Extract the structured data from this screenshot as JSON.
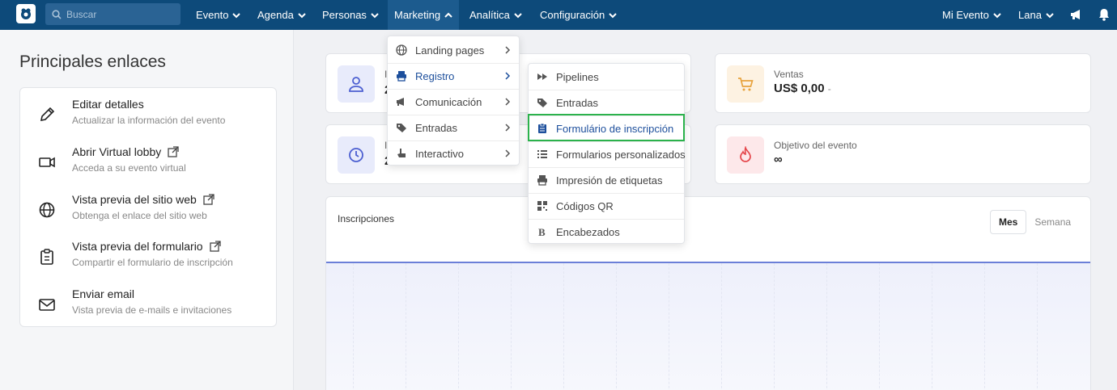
{
  "topbar": {
    "search_placeholder": "Buscar",
    "nav": [
      "Evento",
      "Agenda",
      "Personas",
      "Marketing",
      "Analítica",
      "Configuración"
    ],
    "right": [
      "Mi Evento",
      "Lana"
    ],
    "colors": {
      "bar": "#0d4a7a",
      "active": "#1c5b8e"
    }
  },
  "sidebar": {
    "title": "Principales enlaces",
    "links": [
      {
        "title": "Editar detalles",
        "sub": "Actualizar la información del evento",
        "icon": "pencil-icon",
        "external": false
      },
      {
        "title": "Abrir Virtual lobby",
        "sub": "Acceda a su evento virtual",
        "icon": "video-icon",
        "external": true
      },
      {
        "title": "Vista previa del sitio web",
        "sub": "Obtenga el enlace del sitio web",
        "icon": "globe-icon",
        "external": true
      },
      {
        "title": "Vista previa del formulario",
        "sub": "Compartir el formulario de inscripción",
        "icon": "clipboard-icon",
        "external": true
      },
      {
        "title": "Enviar email",
        "sub": "Vista previa de e-mails e invitaciones",
        "icon": "envelope-icon",
        "external": false
      }
    ]
  },
  "cards": {
    "ventas_label": "Ventas",
    "ventas_value": "US$ 0,00",
    "ventas_dash": "-",
    "objetivo_label": "Objetivo del evento",
    "objetivo_value": "∞",
    "card1_label_partial": "I",
    "card1_value_partial": "2",
    "card2_label_partial": "I",
    "card2_value_partial": "2"
  },
  "chart": {
    "title": "Inscripciones",
    "toggle": [
      "Mes",
      "Semana"
    ],
    "selected": "Mes"
  },
  "marketing_menu": [
    {
      "label": "Landing pages",
      "icon": "globe-icon"
    },
    {
      "label": "Registro",
      "icon": "printer-icon",
      "active": true
    },
    {
      "label": "Comunicación",
      "icon": "megaphone-icon"
    },
    {
      "label": "Entradas",
      "icon": "tags-icon"
    },
    {
      "label": "Interactivo",
      "icon": "hand-pointer-icon"
    }
  ],
  "registro_menu": [
    {
      "label": "Pipelines",
      "icon": "forward-icon"
    },
    {
      "label": "Entradas",
      "icon": "tag-icon"
    },
    {
      "label": "Formulário de inscripción",
      "icon": "clipboard-list-icon",
      "highlighted": true
    },
    {
      "label": "Formularios personalizados",
      "icon": "list-icon"
    },
    {
      "label": "Impresión de etiquetas",
      "icon": "printer-icon"
    },
    {
      "label": "Códigos QR",
      "icon": "qrcode-icon"
    },
    {
      "label": "Encabezados",
      "icon": "bold-icon"
    }
  ]
}
